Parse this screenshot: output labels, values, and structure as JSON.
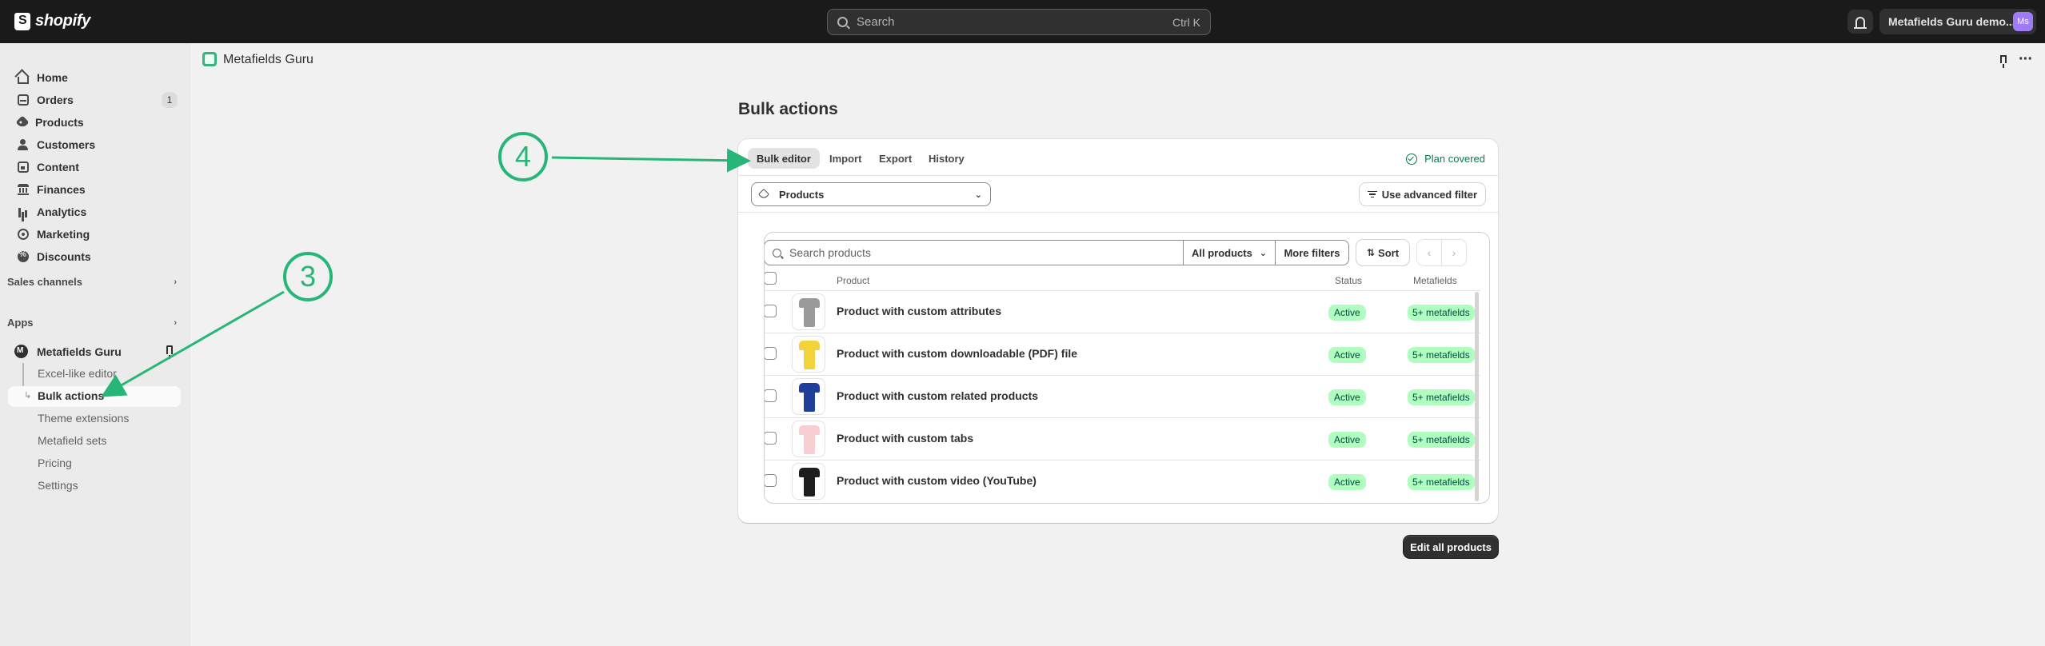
{
  "topbar": {
    "logo_text": "shopify",
    "search_placeholder": "Search",
    "search_shortcut": "Ctrl K",
    "store_name": "Metafields Guru demo...",
    "avatar_initials": "Ms"
  },
  "sidebar": {
    "items": [
      {
        "label": "Home",
        "icon": "home-icon"
      },
      {
        "label": "Orders",
        "icon": "orders-icon",
        "badge": "1"
      },
      {
        "label": "Products",
        "icon": "tag-icon"
      },
      {
        "label": "Customers",
        "icon": "person-icon"
      },
      {
        "label": "Content",
        "icon": "content-icon"
      },
      {
        "label": "Finances",
        "icon": "bank-icon"
      },
      {
        "label": "Analytics",
        "icon": "chart-icon"
      },
      {
        "label": "Marketing",
        "icon": "target-icon"
      },
      {
        "label": "Discounts",
        "icon": "discount-icon"
      }
    ],
    "sales_channels_label": "Sales channels",
    "apps_label": "Apps",
    "app_name": "Metafields Guru",
    "app_subitems": [
      "Excel-like editor",
      "Bulk actions",
      "Theme extensions",
      "Metafield sets",
      "Pricing",
      "Settings"
    ]
  },
  "app_header": {
    "title": "Metafields Guru"
  },
  "page": {
    "title": "Bulk actions",
    "tabs": [
      "Bulk editor",
      "Import",
      "Export",
      "History"
    ],
    "plan_status": "Plan covered",
    "resource_select": "Products",
    "advanced_filter": "Use advanced filter",
    "search_placeholder": "Search products",
    "all_products": "All products",
    "more_filters": "More filters",
    "sort": "Sort",
    "columns": {
      "product": "Product",
      "status": "Status",
      "metafields": "Metafields"
    },
    "rows": [
      {
        "name": "Product with custom attributes",
        "status": "Active",
        "metafields": "5+ metafields",
        "color": "#9a9a9a"
      },
      {
        "name": "Product with custom downloadable (PDF) file",
        "status": "Active",
        "metafields": "5+ metafields",
        "color": "#f2d33b"
      },
      {
        "name": "Product with custom related products",
        "status": "Active",
        "metafields": "5+ metafields",
        "color": "#1f3f9a"
      },
      {
        "name": "Product with custom tabs",
        "status": "Active",
        "metafields": "5+ metafields",
        "color": "#f7cfd2"
      },
      {
        "name": "Product with custom video (YouTube)",
        "status": "Active",
        "metafields": "5+ metafields",
        "color": "#1e1e1e"
      }
    ],
    "edit_all": "Edit all products"
  },
  "annotations": {
    "step3": "3",
    "step4": "4",
    "color": "#28b678"
  }
}
